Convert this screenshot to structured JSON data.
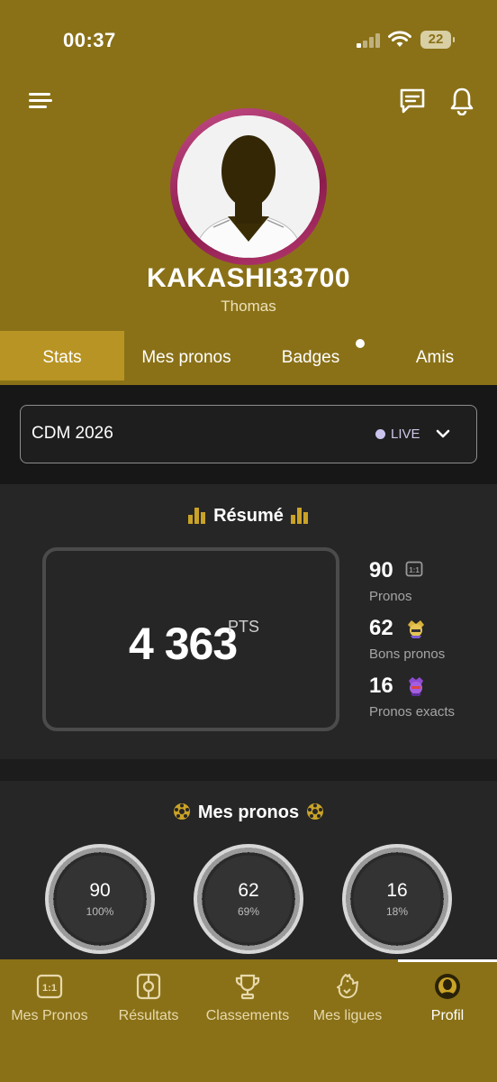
{
  "status_bar": {
    "time": "00:37",
    "battery": "22"
  },
  "profile": {
    "username": "KAKASHI33700",
    "first_name": "Thomas"
  },
  "tabs": [
    {
      "label": "Stats",
      "active": true
    },
    {
      "label": "Mes pronos",
      "active": false
    },
    {
      "label": "Badges",
      "active": false,
      "has_dot": true
    },
    {
      "label": "Amis",
      "active": false
    }
  ],
  "competition": {
    "name": "CDM 2026",
    "status": "LIVE"
  },
  "resume": {
    "title": "Résumé",
    "points": "4 363",
    "points_unit": "PTS",
    "stats": [
      {
        "value": "90",
        "label": "Pronos",
        "icon": "score-icon"
      },
      {
        "value": "62",
        "label": "Bons pronos",
        "icon": "good-prono-icon"
      },
      {
        "value": "16",
        "label": "Pronos exacts",
        "icon": "exact-prono-icon"
      }
    ]
  },
  "mes_pronos": {
    "title": "Mes pronos",
    "rings": [
      {
        "value": "90",
        "percent": "100%"
      },
      {
        "value": "62",
        "percent": "69%"
      },
      {
        "value": "16",
        "percent": "18%"
      }
    ]
  },
  "bottom_nav": [
    {
      "label": "Mes Pronos",
      "icon": "score-icon",
      "active": false
    },
    {
      "label": "Résultats",
      "icon": "scoreboard-icon",
      "active": false
    },
    {
      "label": "Classements",
      "icon": "trophy-icon",
      "active": false
    },
    {
      "label": "Mes ligues",
      "icon": "rooster-icon",
      "active": false
    },
    {
      "label": "Profil",
      "icon": "profile-icon",
      "active": true
    }
  ],
  "colors": {
    "header_bg": "#8a7117",
    "tab_active": "#b89424",
    "accent_gold": "#c9a227",
    "avatar_ring": "#b5386f"
  }
}
